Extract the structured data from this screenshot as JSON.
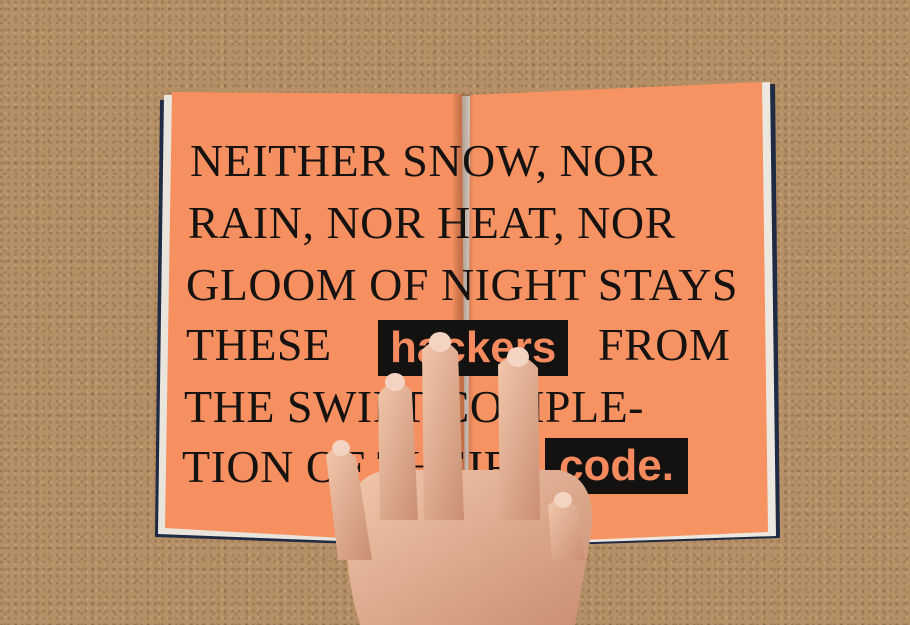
{
  "zine": {
    "lines": [
      "NEITHER SNOW, NOR",
      "RAIN, NOR HEAT, NOR",
      "GLOOM OF NIGHT STAYS",
      "THESE",
      "FROM",
      "THE SWIFT COMPLE-",
      "TION OF THEIR"
    ],
    "highlight_hackers": "hackers",
    "highlight_code": "code."
  },
  "colors": {
    "page": "#f7915f",
    "ink": "#161210",
    "cork": "#b58f66"
  }
}
